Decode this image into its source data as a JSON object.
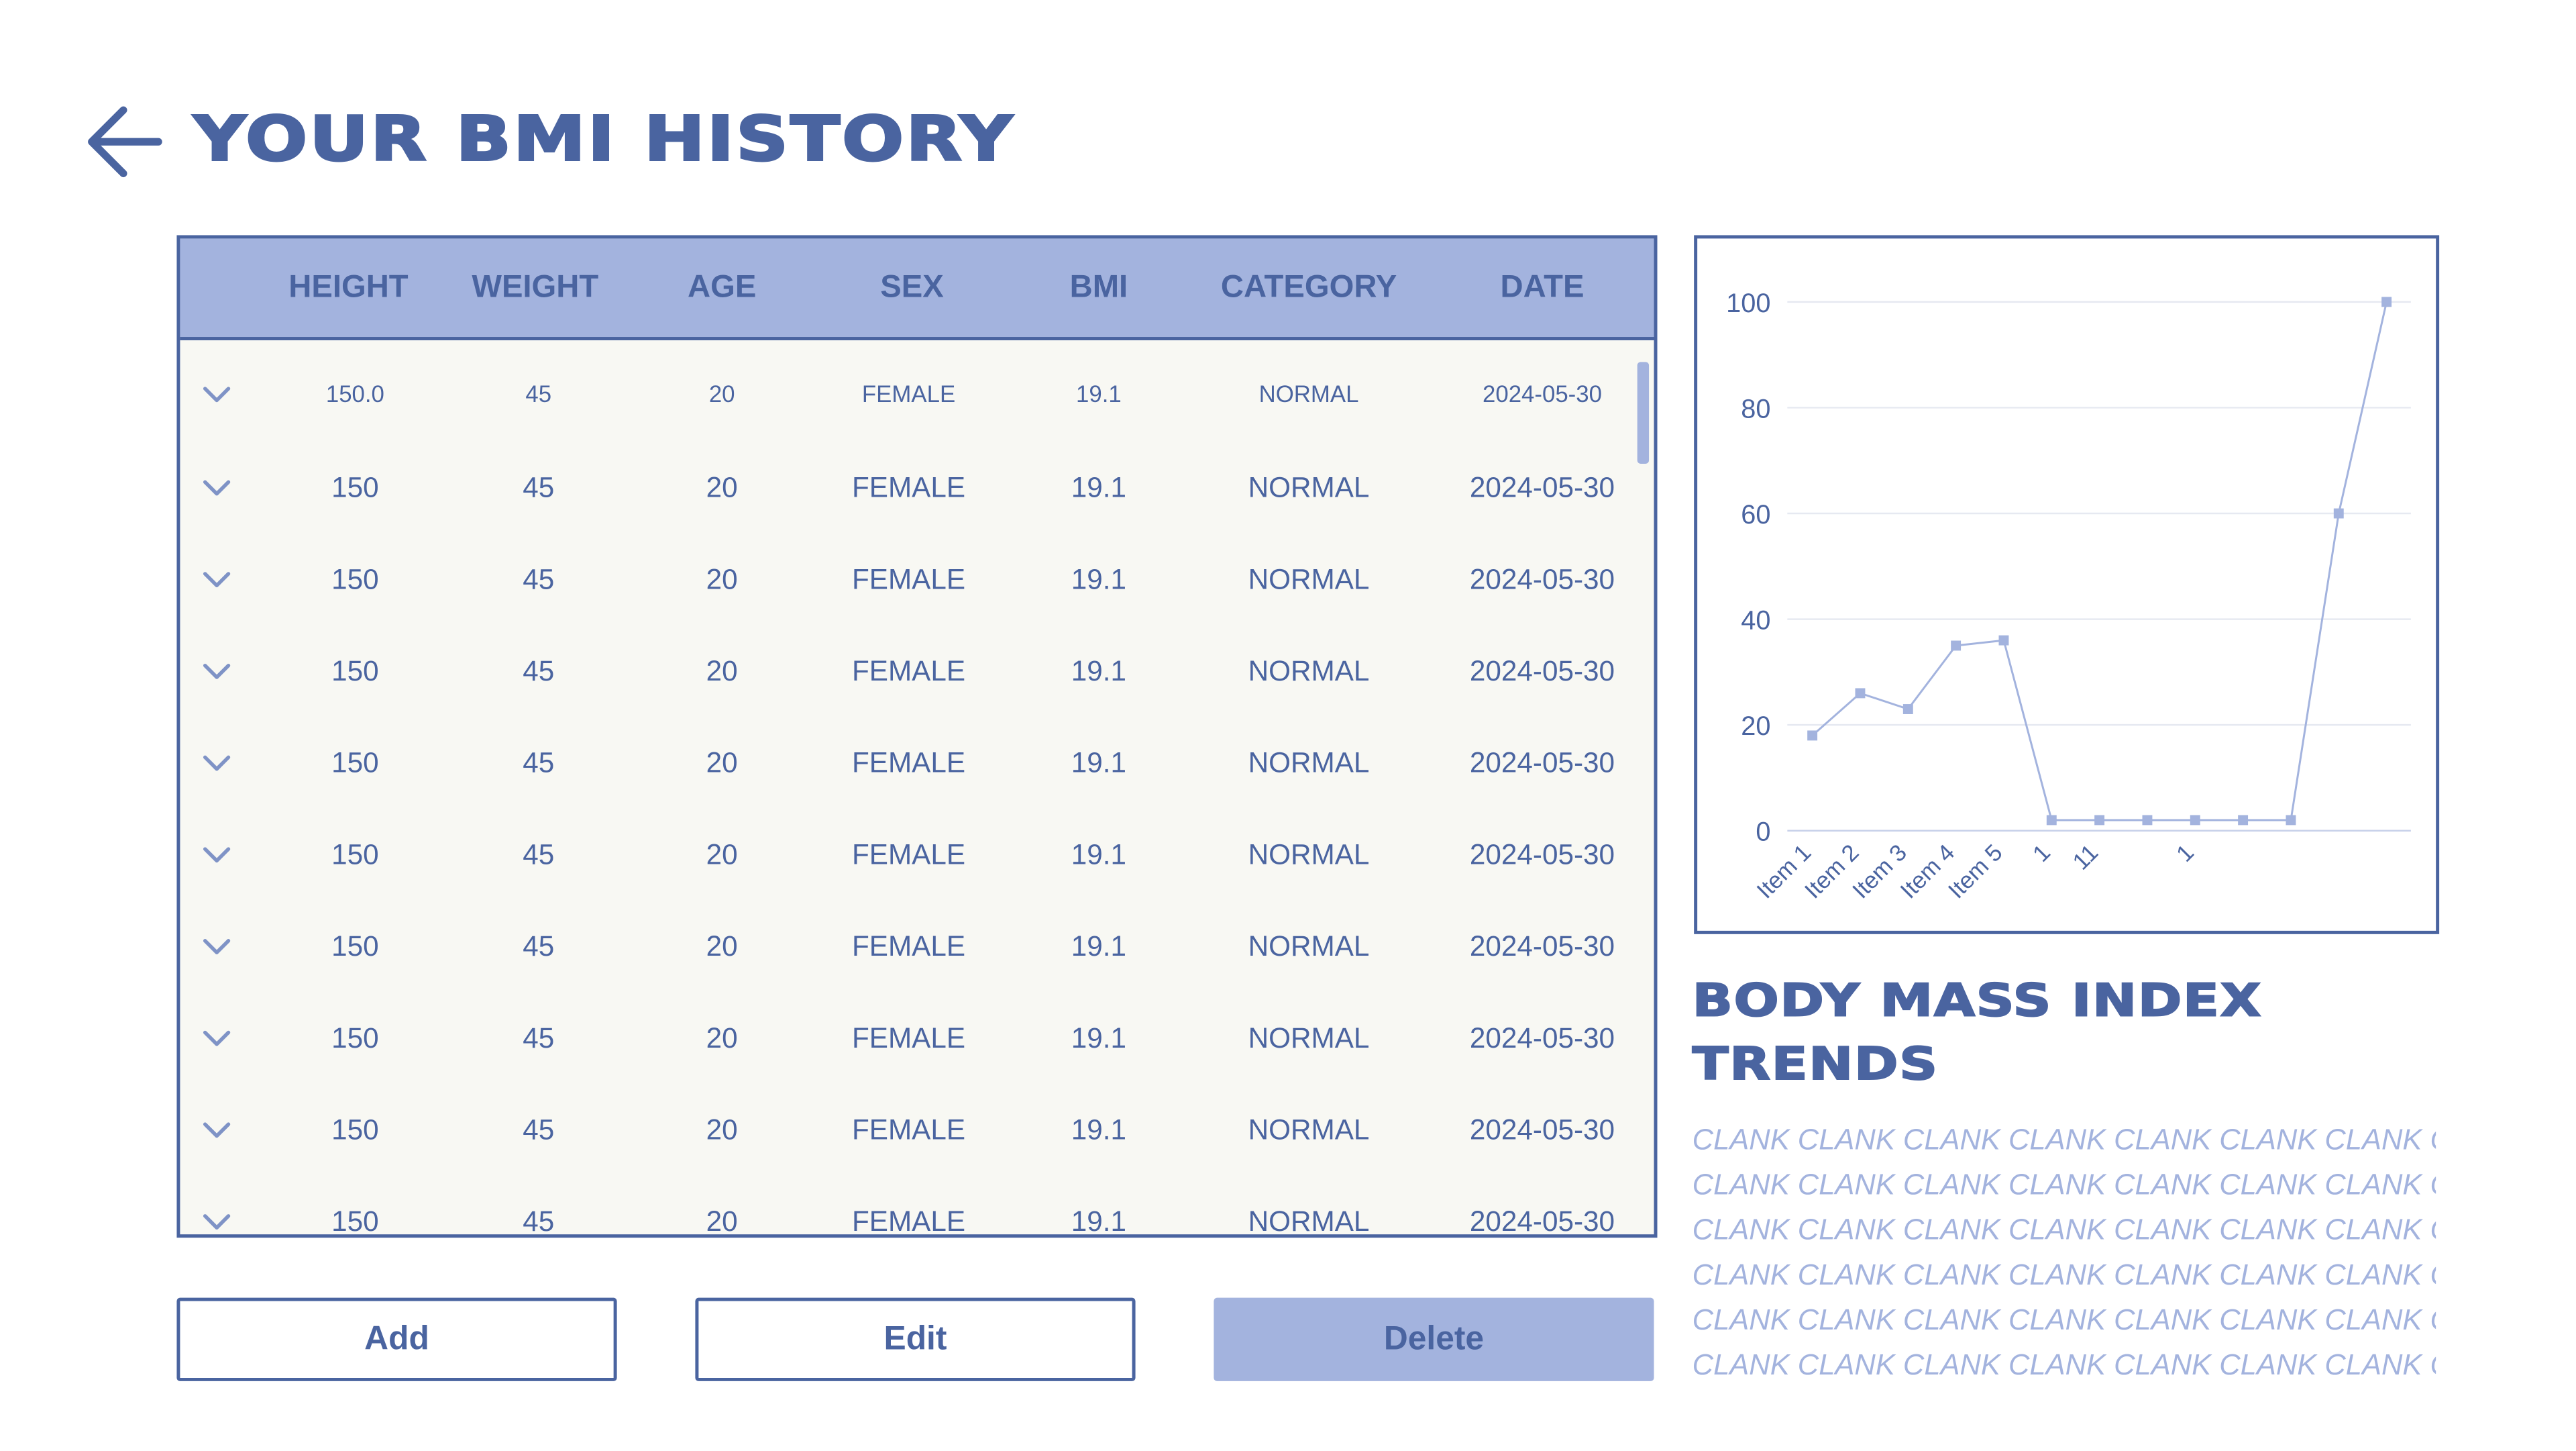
{
  "header": {
    "title": "YOUR BMI HISTORY",
    "back_icon": "arrow-left-icon"
  },
  "table": {
    "columns": [
      "HEIGHT",
      "WEIGHT",
      "AGE",
      "SEX",
      "BMI",
      "CATEGORY",
      "DATE"
    ],
    "rows": [
      [
        "150.0",
        "45",
        "20",
        "FEMALE",
        "19.1",
        "NORMAL",
        "2024-05-30"
      ],
      [
        "150",
        "45",
        "20",
        "FEMALE",
        "19.1",
        "NORMAL",
        "2024-05-30"
      ],
      [
        "150",
        "45",
        "20",
        "FEMALE",
        "19.1",
        "NORMAL",
        "2024-05-30"
      ],
      [
        "150",
        "45",
        "20",
        "FEMALE",
        "19.1",
        "NORMAL",
        "2024-05-30"
      ],
      [
        "150",
        "45",
        "20",
        "FEMALE",
        "19.1",
        "NORMAL",
        "2024-05-30"
      ],
      [
        "150",
        "45",
        "20",
        "FEMALE",
        "19.1",
        "NORMAL",
        "2024-05-30"
      ],
      [
        "150",
        "45",
        "20",
        "FEMALE",
        "19.1",
        "NORMAL",
        "2024-05-30"
      ],
      [
        "150",
        "45",
        "20",
        "FEMALE",
        "19.1",
        "NORMAL",
        "2024-05-30"
      ],
      [
        "150",
        "45",
        "20",
        "FEMALE",
        "19.1",
        "NORMAL",
        "2024-05-30"
      ],
      [
        "150",
        "45",
        "20",
        "FEMALE",
        "19.1",
        "NORMAL",
        "2024-05-30"
      ]
    ],
    "row_icon": "chevron-down-icon"
  },
  "buttons": {
    "add": "Add",
    "edit": "Edit",
    "delete": "Delete"
  },
  "chart_data": {
    "type": "line",
    "x": [
      "Item 1",
      "Item 2",
      "Item 3",
      "Item 4",
      "Item 5",
      "1",
      "11",
      "",
      "1",
      "",
      ""
    ],
    "values": [
      18,
      26,
      23,
      35,
      36,
      2,
      2,
      2,
      2,
      2,
      2,
      60,
      100
    ],
    "x_visible_labels": [
      "Item 1",
      "Item 2",
      "Item 3",
      "Item 4",
      "Item 5",
      "1",
      "11",
      "",
      "1",
      "",
      "",
      "",
      ""
    ],
    "yticks": [
      0,
      20,
      40,
      60,
      80,
      100
    ],
    "ylim": [
      0,
      100
    ],
    "grid": true,
    "line_color": "#a3b3de"
  },
  "section": {
    "title_line1": "BODY MASS INDEX",
    "title_line2": "TRENDS",
    "lorem_lines": [
      "CLANK CLANK CLANK CLANK CLANK CLANK CLANK CL",
      "CLANK CLANK CLANK CLANK CLANK CLANK CLANK CL",
      "CLANK CLANK CLANK CLANK CLANK CLANK CLANK CL",
      "CLANK CLANK CLANK CLANK CLANK CLANK CLANK CL",
      "CLANK CLANK CLANK CLANK CLANK CLANK CLANK CL",
      "CLANK CLANK CLANK CLANK CLANK CLANK CLANK CL"
    ]
  },
  "colors": {
    "primary": "#4a64a0",
    "accent": "#a3b3de",
    "table_bg": "#f8f8f3"
  }
}
